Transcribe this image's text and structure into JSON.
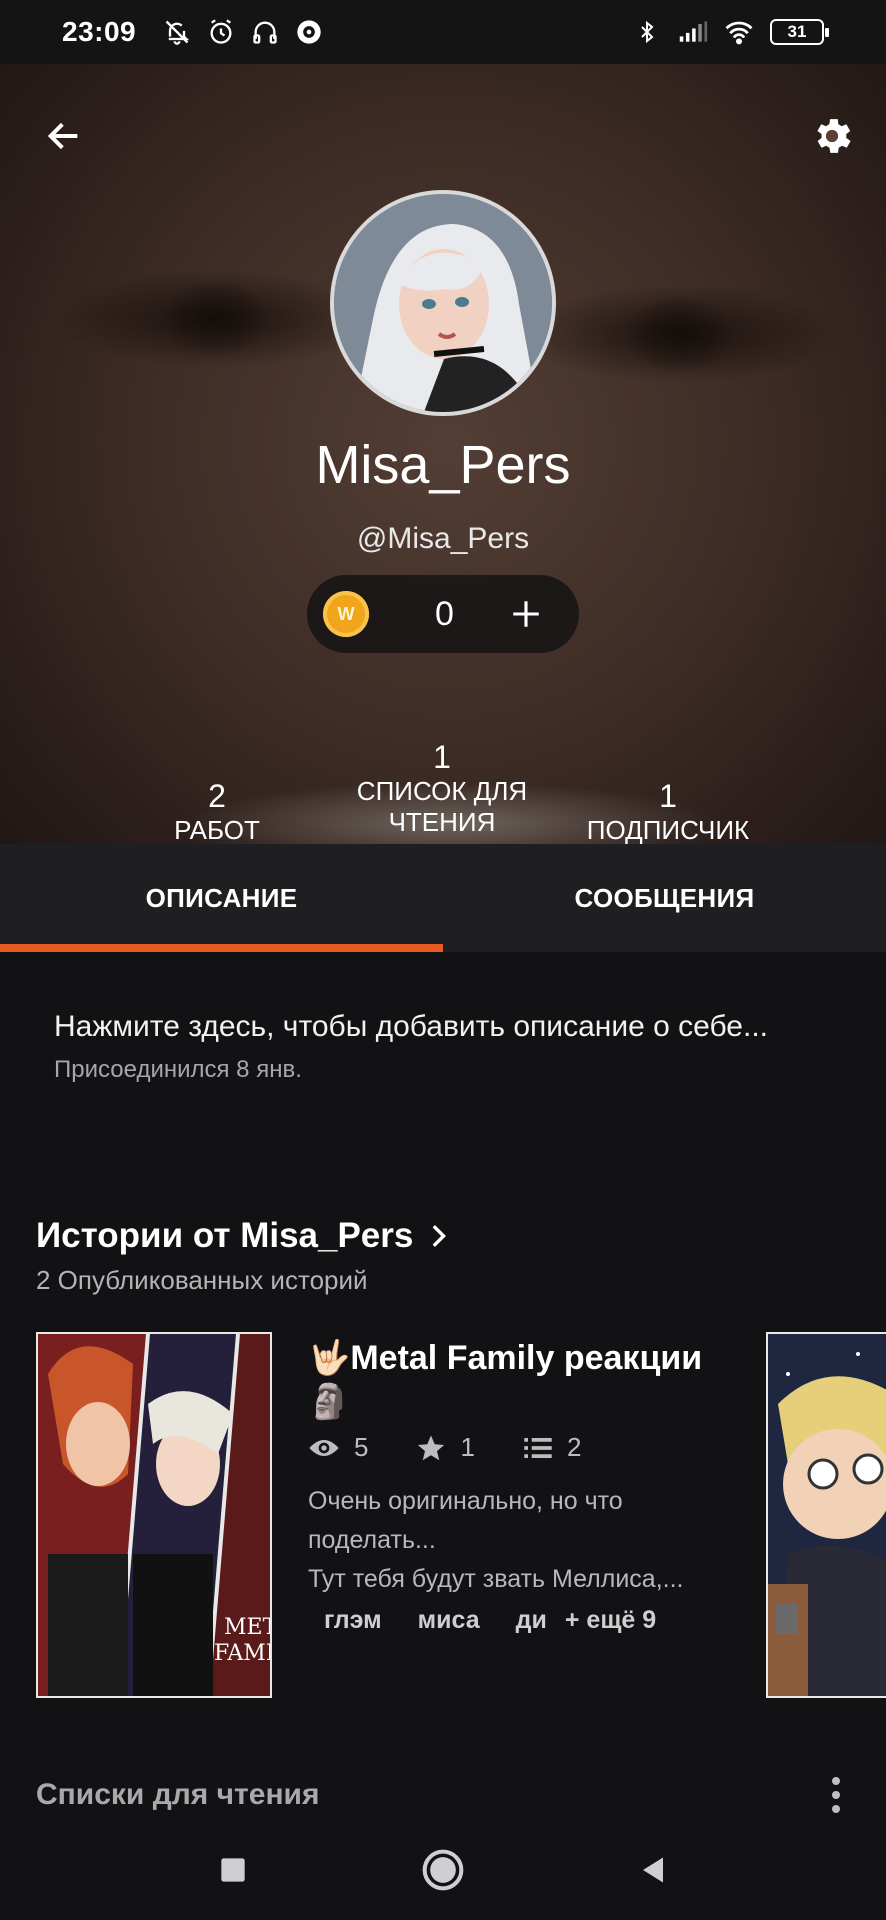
{
  "status_bar": {
    "time": "23:09",
    "battery": "31",
    "left_icons": [
      "bell-off-icon",
      "alarm-icon",
      "headphones-icon",
      "media-icon"
    ],
    "right_icons": [
      "bluetooth-icon",
      "signal-icon",
      "wifi-icon",
      "battery-icon"
    ]
  },
  "profile": {
    "display_name": "Misa_Pers",
    "handle": "@Misa_Pers",
    "coins": "0",
    "coin_symbol": "W",
    "stats": [
      {
        "value": "2",
        "label_line1": "РАБОТ",
        "label_line2": ""
      },
      {
        "value": "1",
        "label_line1": "СПИСОК ДЛЯ",
        "label_line2": "ЧТЕНИЯ"
      },
      {
        "value": "1",
        "label_line1": "ПОДПИСЧИК",
        "label_line2": ""
      }
    ]
  },
  "tabs": [
    {
      "label": "ОПИСАНИЕ",
      "active": true
    },
    {
      "label": "СООБЩЕНИЯ",
      "active": false
    }
  ],
  "about": {
    "prompt": "Нажмите здесь, чтобы добавить описание о себе...",
    "joined": "Присоединился 8 янв."
  },
  "stories": {
    "title": "Истории от Misa_Pers",
    "subtitle": "2 Опубликованных историй",
    "items": [
      {
        "title_line1": "🤟🏻Metal Family реакции",
        "title_line2": "🗿",
        "views": "5",
        "votes": "1",
        "parts": "2",
        "desc_line1": "Очень оригинально, но что",
        "desc_line2": "поделать...",
        "desc_line3": "Тут тебя будут звать Меллиса,...",
        "tags": [
          "глэм",
          "миса",
          "ди"
        ],
        "more_tags": "+ ещё 9",
        "cover_text": "METAL FAMILY"
      }
    ]
  },
  "reading_lists": {
    "title": "Списки для чтения"
  },
  "colors": {
    "accent": "#e65b1e",
    "background": "#121113",
    "tab_bar": "#1f1e21",
    "coin": "#f0a51c"
  }
}
